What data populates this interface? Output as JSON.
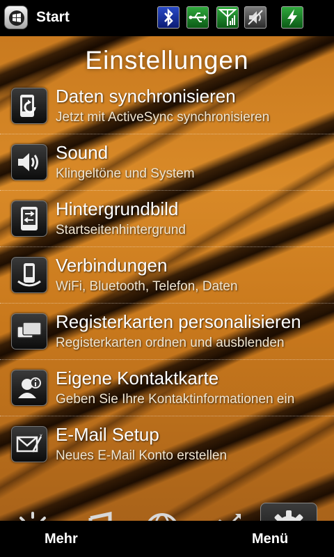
{
  "statusbar": {
    "start_label": "Start",
    "icons": [
      "windows-logo-icon",
      "bluetooth-icon",
      "usb-icon",
      "signal-icon",
      "volume-icon",
      "battery-charging-icon"
    ]
  },
  "page": {
    "title": "Einstellungen"
  },
  "items": [
    {
      "icon": "sync-icon",
      "title": "Daten synchronisieren",
      "subtitle": "Jetzt mit ActiveSync synchronisieren"
    },
    {
      "icon": "speaker-icon",
      "title": "Sound",
      "subtitle": "Klingeltöne und System"
    },
    {
      "icon": "wallpaper-icon",
      "title": "Hintergrundbild",
      "subtitle": "Startseitenhintergrund"
    },
    {
      "icon": "connections-icon",
      "title": "Verbindungen",
      "subtitle": "WiFi, Bluetooth, Telefon, Daten"
    },
    {
      "icon": "tabs-icon",
      "title": "Registerkarten personalisieren",
      "subtitle": "Registerkarten ordnen und ausblenden"
    },
    {
      "icon": "contact-card-icon",
      "title": "Eigene Kontaktkarte",
      "subtitle": "Geben Sie Ihre Kontaktinformationen ein"
    },
    {
      "icon": "email-setup-icon",
      "title": "E-Mail Setup",
      "subtitle": "Neues E-Mail Konto erstellen"
    }
  ],
  "tabs": [
    "weather-icon",
    "music-icon",
    "internet-icon",
    "stocks-icon",
    "settings-gear-icon"
  ],
  "softkeys": {
    "left": "Mehr",
    "right": "Menü"
  },
  "colors": {
    "accent_green": "#2fa83c",
    "bluetooth_blue": "#1f3fb8",
    "tiger_orange": "#d98a28"
  }
}
